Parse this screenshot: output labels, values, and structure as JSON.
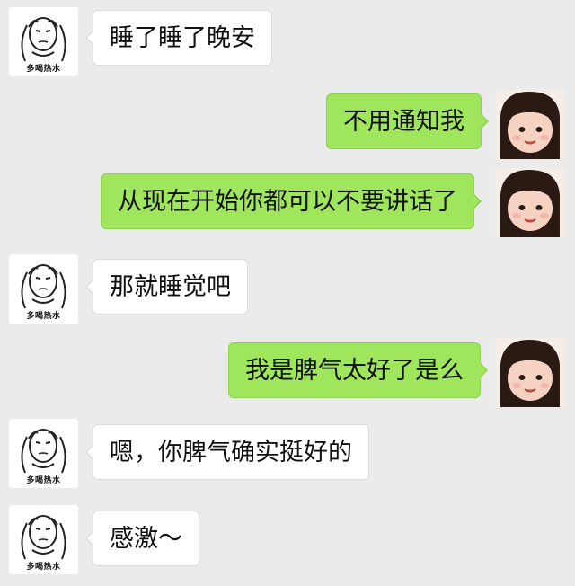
{
  "contact": {
    "avatar_caption": "多喝热水",
    "avatar_icon": "meme-face-icon"
  },
  "me": {
    "avatar_icon": "girl-photo-icon"
  },
  "colors": {
    "background": "#ebebeb",
    "sent_bubble": "#9fe65c",
    "received_bubble": "#ffffff"
  },
  "messages": [
    {
      "sender": "contact",
      "text": "睡了睡了晚安"
    },
    {
      "sender": "me",
      "text": "不用通知我"
    },
    {
      "sender": "me",
      "text": "从现在开始你都可以不要讲话了"
    },
    {
      "sender": "contact",
      "text": "那就睡觉吧"
    },
    {
      "sender": "me",
      "text": "我是脾气太好了是么"
    },
    {
      "sender": "contact",
      "text": "嗯，你脾气确实挺好的"
    },
    {
      "sender": "contact",
      "text": "感激～"
    }
  ]
}
